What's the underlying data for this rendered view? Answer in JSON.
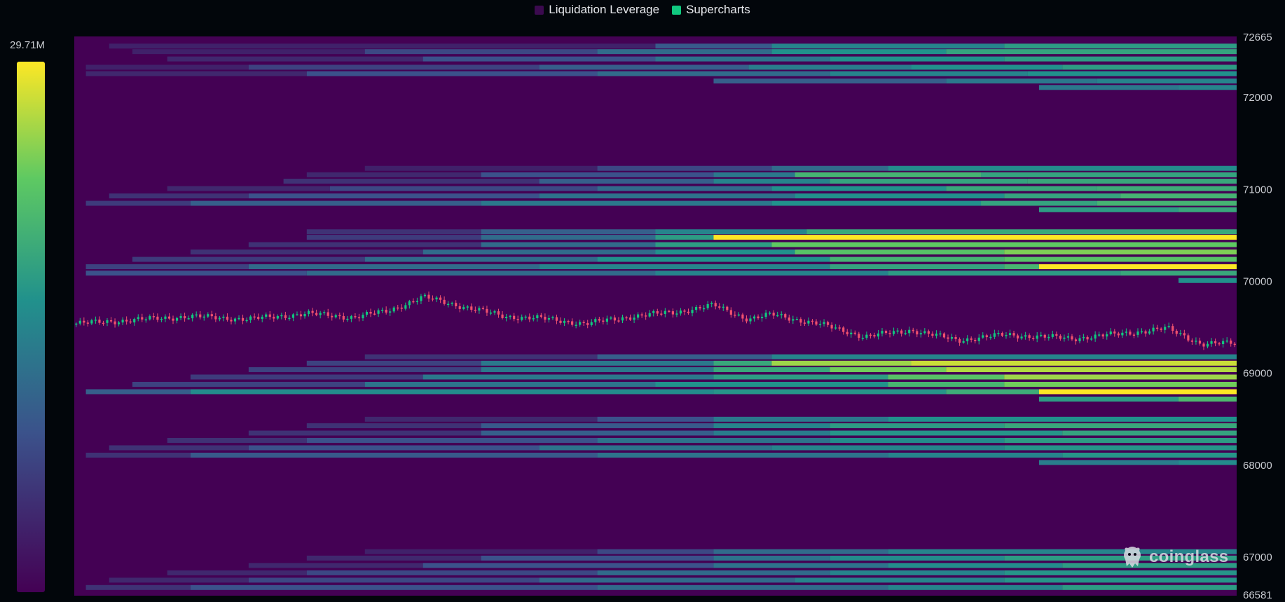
{
  "legend": {
    "items": [
      {
        "label": "Liquidation Leverage",
        "color": "#3b0a4f"
      },
      {
        "label": "Supercharts",
        "color": "#10c87f"
      }
    ]
  },
  "colorbar": {
    "max_label": "29.71M",
    "min_value": 0,
    "max_value": 29710000,
    "colorscale": [
      "#440154",
      "#3b528b",
      "#21918c",
      "#5ec962",
      "#fde725"
    ]
  },
  "watermark": {
    "text": "coinglass",
    "icon": "coinglass-logo-icon"
  },
  "chart_data": {
    "type": "heatmap",
    "title": "",
    "y_axis": {
      "position": "right",
      "range": [
        66581,
        72665
      ],
      "tick_labels": [
        "72665",
        "72000",
        "71000",
        "70000",
        "69000",
        "68000",
        "67000",
        "66581"
      ],
      "ticks": [
        72665,
        72000,
        71000,
        70000,
        69000,
        68000,
        67000,
        66581
      ]
    },
    "x_axis": {
      "range": [
        0,
        100
      ],
      "tick_labels": []
    },
    "bands": [
      {
        "price": 72560,
        "levels": [
          [
            3,
            0.1
          ],
          [
            50,
            0.28
          ],
          [
            60,
            0.45
          ],
          [
            80,
            0.55
          ]
        ]
      },
      {
        "price": 72500,
        "levels": [
          [
            5,
            0.1
          ],
          [
            25,
            0.22
          ],
          [
            45,
            0.35
          ],
          [
            60,
            0.5
          ],
          [
            75,
            0.58
          ]
        ]
      },
      {
        "price": 72420,
        "levels": [
          [
            8,
            0.12
          ],
          [
            30,
            0.25
          ],
          [
            50,
            0.38
          ],
          [
            65,
            0.5
          ],
          [
            80,
            0.55
          ]
        ]
      },
      {
        "price": 72330,
        "levels": [
          [
            1,
            0.1
          ],
          [
            15,
            0.2
          ],
          [
            40,
            0.3
          ],
          [
            58,
            0.42
          ],
          [
            72,
            0.5
          ],
          [
            85,
            0.55
          ]
        ]
      },
      {
        "price": 72260,
        "levels": [
          [
            1,
            0.12
          ],
          [
            20,
            0.25
          ],
          [
            45,
            0.35
          ],
          [
            65,
            0.45
          ],
          [
            82,
            0.5
          ]
        ]
      },
      {
        "price": 72180,
        "levels": [
          [
            55,
            0.3
          ],
          [
            75,
            0.4
          ],
          [
            88,
            0.45
          ]
        ]
      },
      {
        "price": 72110,
        "levels": [
          [
            83,
            0.4
          ],
          [
            95,
            0.45
          ]
        ]
      },
      {
        "price": 71230,
        "levels": [
          [
            25,
            0.1
          ],
          [
            45,
            0.22
          ],
          [
            60,
            0.35
          ],
          [
            70,
            0.48
          ]
        ]
      },
      {
        "price": 71160,
        "levels": [
          [
            20,
            0.12
          ],
          [
            35,
            0.25
          ],
          [
            55,
            0.4
          ],
          [
            62,
            0.65
          ],
          [
            78,
            0.58
          ]
        ]
      },
      {
        "price": 71090,
        "levels": [
          [
            18,
            0.15
          ],
          [
            40,
            0.3
          ],
          [
            55,
            0.45
          ],
          [
            65,
            0.58
          ],
          [
            82,
            0.6
          ]
        ]
      },
      {
        "price": 71010,
        "levels": [
          [
            8,
            0.12
          ],
          [
            22,
            0.22
          ],
          [
            45,
            0.35
          ],
          [
            60,
            0.5
          ],
          [
            75,
            0.6
          ],
          [
            88,
            0.62
          ]
        ]
      },
      {
        "price": 70930,
        "levels": [
          [
            3,
            0.15
          ],
          [
            15,
            0.25
          ],
          [
            40,
            0.38
          ],
          [
            62,
            0.5
          ],
          [
            80,
            0.58
          ],
          [
            90,
            0.65
          ]
        ]
      },
      {
        "price": 70850,
        "levels": [
          [
            1,
            0.18
          ],
          [
            10,
            0.3
          ],
          [
            35,
            0.4
          ],
          [
            60,
            0.5
          ],
          [
            78,
            0.58
          ],
          [
            88,
            0.65
          ]
        ]
      },
      {
        "price": 70780,
        "levels": [
          [
            83,
            0.55
          ],
          [
            95,
            0.6
          ]
        ]
      },
      {
        "price": 70540,
        "levels": [
          [
            20,
            0.15
          ],
          [
            35,
            0.3
          ],
          [
            50,
            0.45
          ],
          [
            63,
            0.6
          ]
        ]
      },
      {
        "price": 70480,
        "levels": [
          [
            20,
            0.18
          ],
          [
            35,
            0.35
          ],
          [
            50,
            0.55
          ],
          [
            55,
            1.0
          ]
        ]
      },
      {
        "price": 70400,
        "levels": [
          [
            15,
            0.15
          ],
          [
            35,
            0.35
          ],
          [
            50,
            0.55
          ],
          [
            60,
            0.75
          ]
        ]
      },
      {
        "price": 70320,
        "levels": [
          [
            10,
            0.15
          ],
          [
            30,
            0.35
          ],
          [
            50,
            0.5
          ],
          [
            62,
            0.72
          ],
          [
            80,
            0.8
          ]
        ]
      },
      {
        "price": 70240,
        "levels": [
          [
            5,
            0.18
          ],
          [
            25,
            0.35
          ],
          [
            45,
            0.5
          ],
          [
            65,
            0.65
          ],
          [
            80,
            0.72
          ]
        ]
      },
      {
        "price": 70160,
        "levels": [
          [
            1,
            0.2
          ],
          [
            15,
            0.35
          ],
          [
            40,
            0.45
          ],
          [
            65,
            0.58
          ],
          [
            80,
            0.66
          ],
          [
            83,
            1.0
          ]
        ]
      },
      {
        "price": 70090,
        "levels": [
          [
            1,
            0.25
          ],
          [
            20,
            0.35
          ],
          [
            50,
            0.45
          ],
          [
            70,
            0.55
          ],
          [
            90,
            0.6
          ]
        ]
      },
      {
        "price": 70010,
        "levels": [
          [
            95,
            0.5
          ]
        ]
      },
      {
        "price": 69180,
        "levels": [
          [
            25,
            0.15
          ],
          [
            45,
            0.3
          ],
          [
            60,
            0.45
          ]
        ]
      },
      {
        "price": 69110,
        "levels": [
          [
            20,
            0.2
          ],
          [
            35,
            0.4
          ],
          [
            55,
            0.6
          ],
          [
            60,
            0.85
          ],
          [
            72,
            0.92
          ]
        ]
      },
      {
        "price": 69040,
        "levels": [
          [
            15,
            0.2
          ],
          [
            35,
            0.4
          ],
          [
            55,
            0.6
          ],
          [
            65,
            0.78
          ],
          [
            75,
            0.88
          ]
        ]
      },
      {
        "price": 68960,
        "levels": [
          [
            10,
            0.18
          ],
          [
            30,
            0.4
          ],
          [
            55,
            0.55
          ],
          [
            70,
            0.72
          ],
          [
            80,
            0.85
          ]
        ]
      },
      {
        "price": 68880,
        "levels": [
          [
            5,
            0.2
          ],
          [
            25,
            0.38
          ],
          [
            50,
            0.5
          ],
          [
            70,
            0.66
          ],
          [
            80,
            0.78
          ]
        ]
      },
      {
        "price": 68800,
        "levels": [
          [
            1,
            0.3
          ],
          [
            10,
            0.48
          ],
          [
            55,
            0.52
          ],
          [
            75,
            0.62
          ],
          [
            83,
            1.0
          ]
        ]
      },
      {
        "price": 68720,
        "levels": [
          [
            83,
            0.55
          ],
          [
            95,
            0.68
          ]
        ]
      },
      {
        "price": 68500,
        "levels": [
          [
            25,
            0.12
          ],
          [
            45,
            0.25
          ],
          [
            55,
            0.4
          ],
          [
            70,
            0.5
          ]
        ]
      },
      {
        "price": 68430,
        "levels": [
          [
            20,
            0.15
          ],
          [
            35,
            0.28
          ],
          [
            55,
            0.45
          ],
          [
            65,
            0.55
          ],
          [
            80,
            0.6
          ]
        ]
      },
      {
        "price": 68350,
        "levels": [
          [
            15,
            0.15
          ],
          [
            35,
            0.3
          ],
          [
            55,
            0.42
          ],
          [
            65,
            0.52
          ],
          [
            85,
            0.58
          ]
        ]
      },
      {
        "price": 68270,
        "levels": [
          [
            8,
            0.15
          ],
          [
            20,
            0.25
          ],
          [
            45,
            0.38
          ],
          [
            65,
            0.48
          ],
          [
            80,
            0.55
          ]
        ]
      },
      {
        "price": 68190,
        "levels": [
          [
            3,
            0.15
          ],
          [
            15,
            0.25
          ],
          [
            40,
            0.38
          ],
          [
            60,
            0.45
          ],
          [
            80,
            0.52
          ]
        ]
      },
      {
        "price": 68110,
        "levels": [
          [
            1,
            0.15
          ],
          [
            10,
            0.28
          ],
          [
            45,
            0.38
          ],
          [
            70,
            0.45
          ],
          [
            85,
            0.52
          ]
        ]
      },
      {
        "price": 68030,
        "levels": [
          [
            83,
            0.42
          ],
          [
            95,
            0.48
          ]
        ]
      },
      {
        "price": 67060,
        "levels": [
          [
            25,
            0.1
          ],
          [
            45,
            0.22
          ],
          [
            55,
            0.35
          ],
          [
            70,
            0.45
          ]
        ]
      },
      {
        "price": 66990,
        "levels": [
          [
            20,
            0.12
          ],
          [
            35,
            0.25
          ],
          [
            55,
            0.38
          ],
          [
            65,
            0.48
          ],
          [
            80,
            0.55
          ]
        ]
      },
      {
        "price": 66910,
        "levels": [
          [
            15,
            0.12
          ],
          [
            30,
            0.25
          ],
          [
            55,
            0.38
          ],
          [
            70,
            0.48
          ],
          [
            85,
            0.55
          ]
        ]
      },
      {
        "price": 66830,
        "levels": [
          [
            8,
            0.12
          ],
          [
            20,
            0.22
          ],
          [
            45,
            0.35
          ],
          [
            65,
            0.45
          ],
          [
            80,
            0.52
          ]
        ]
      },
      {
        "price": 66750,
        "levels": [
          [
            3,
            0.12
          ],
          [
            15,
            0.22
          ],
          [
            40,
            0.35
          ],
          [
            62,
            0.45
          ],
          [
            80,
            0.52
          ]
        ]
      },
      {
        "price": 66670,
        "levels": [
          [
            1,
            0.15
          ],
          [
            10,
            0.25
          ],
          [
            45,
            0.35
          ],
          [
            70,
            0.45
          ],
          [
            85,
            0.55
          ]
        ]
      }
    ],
    "price_series": {
      "name": "Supercharts",
      "type": "candlestick",
      "up_color": "#10c87f",
      "down_color": "#f0506e",
      "x": [
        0,
        5,
        10,
        15,
        20,
        24,
        27,
        30,
        33,
        37,
        40,
        44,
        48,
        52,
        55,
        58,
        60,
        64,
        68,
        72,
        76,
        80,
        83,
        86,
        90,
        94,
        97,
        100
      ],
      "close": [
        69540,
        69580,
        69620,
        69590,
        69650,
        69610,
        69680,
        69830,
        69740,
        69620,
        69600,
        69540,
        69620,
        69670,
        69740,
        69590,
        69640,
        69540,
        69400,
        69470,
        69360,
        69420,
        69400,
        69380,
        69430,
        69490,
        69320,
        69330
      ]
    }
  }
}
